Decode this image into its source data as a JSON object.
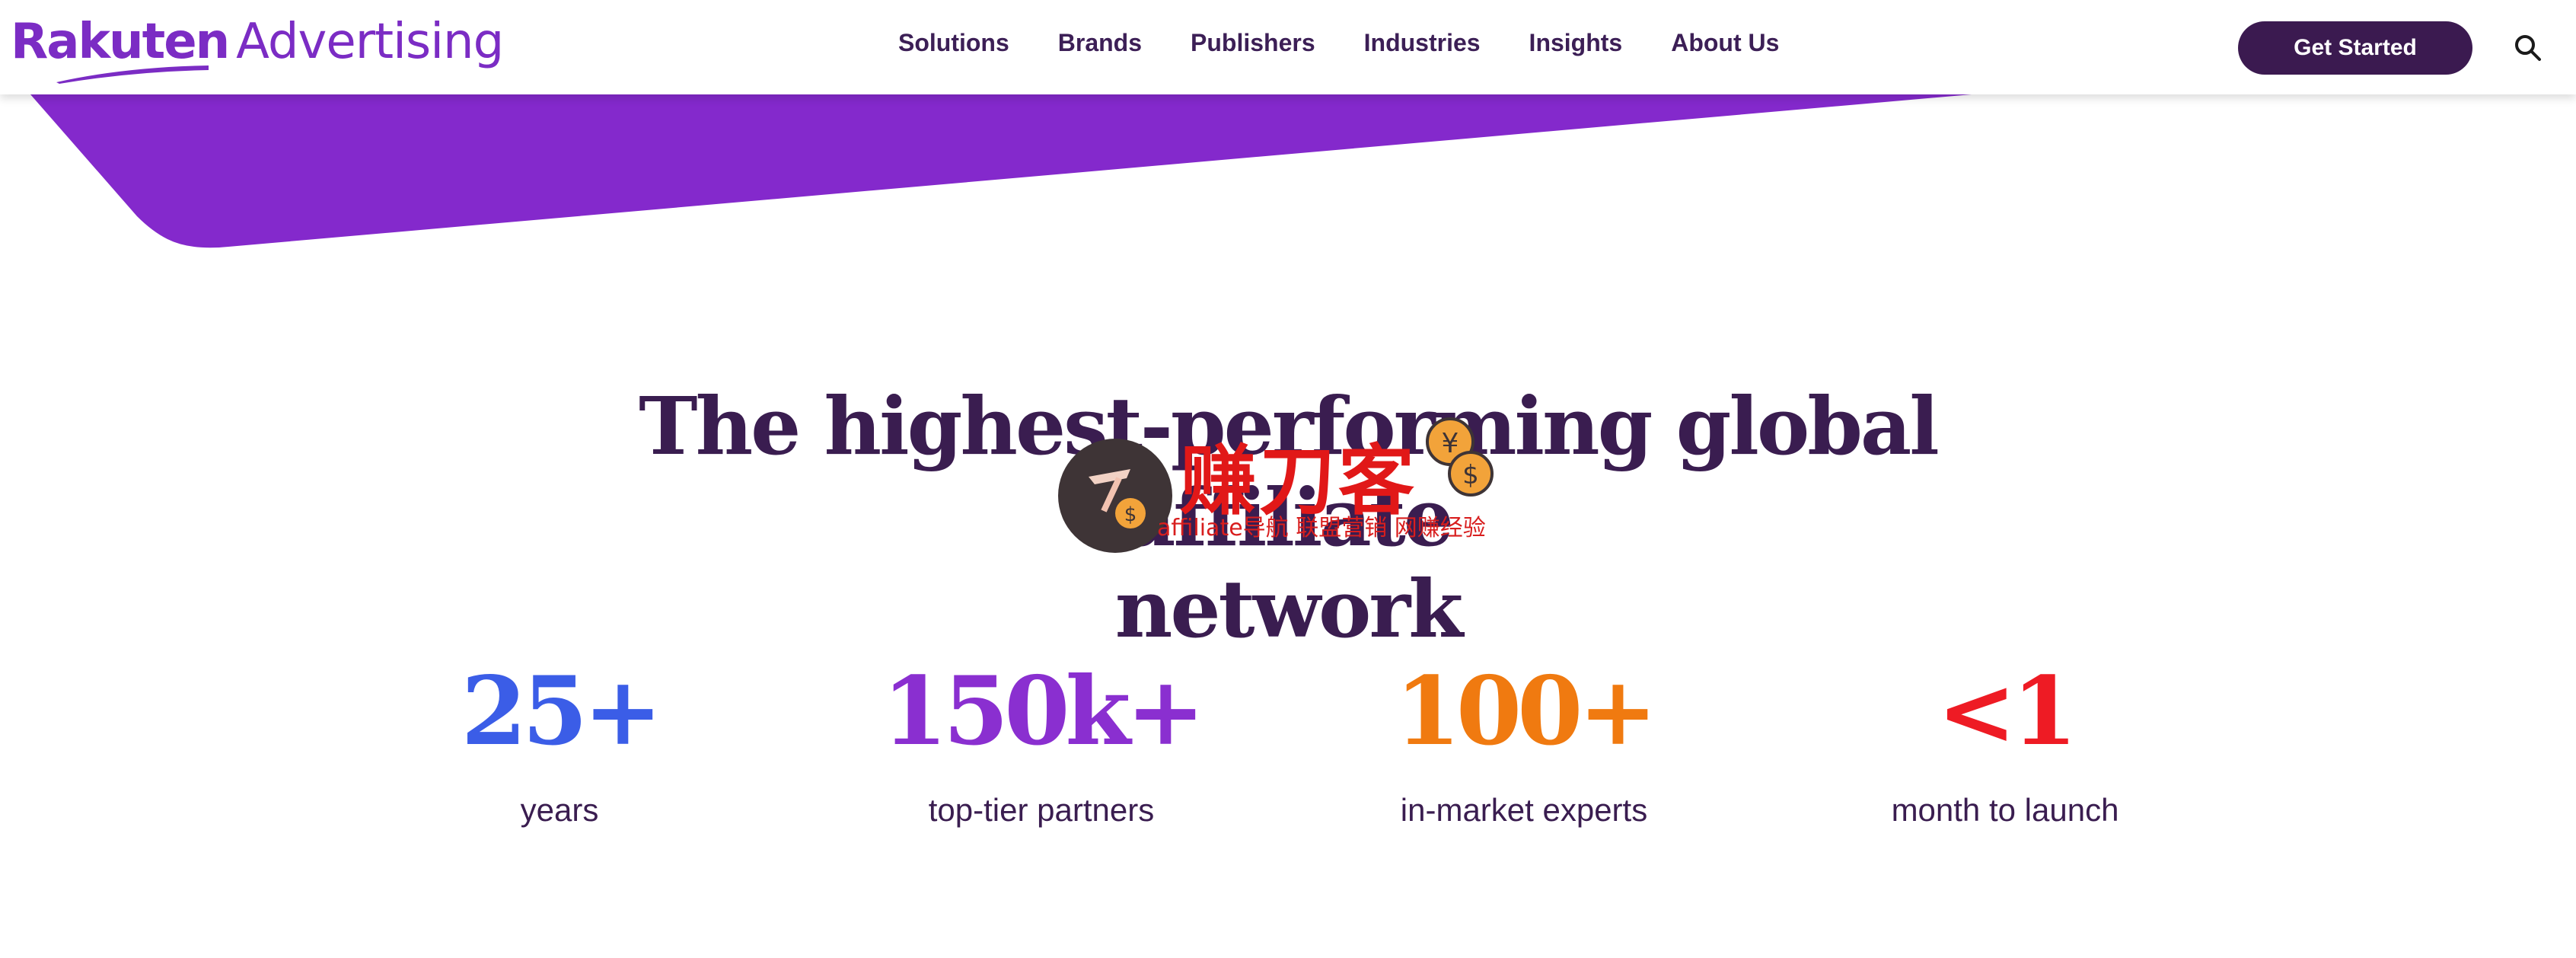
{
  "brand": {
    "logo_text_bold": "Rakuten",
    "logo_text_regular": "Advertising",
    "color": "#7b2cc4"
  },
  "nav": {
    "items": [
      "Solutions",
      "Brands",
      "Publishers",
      "Industries",
      "Insights",
      "About Us"
    ]
  },
  "header": {
    "cta_label": "Get Started",
    "search_icon": "search-icon"
  },
  "hero": {
    "headline_line1": "The highest-performing global affiliate",
    "headline_line2": "network"
  },
  "watermark": {
    "title": "赚刀客",
    "subtitle": "affiliate导航 联盟营销 网赚经验"
  },
  "stats": [
    {
      "value": "25+",
      "label": "years",
      "color": "#3b5de7"
    },
    {
      "value": "150k+",
      "label": "top-tier partners",
      "color": "#8a2fd0"
    },
    {
      "value": "100+",
      "label": "in-market experts",
      "color": "#f07a10"
    },
    {
      "value": "<1",
      "label": "month to launch",
      "color": "#ee1b24"
    }
  ],
  "colors": {
    "banner": "#8429cc",
    "nav_text": "#3c1f56",
    "cta_bg": "#3b1a50",
    "headline": "#3a1d50"
  }
}
